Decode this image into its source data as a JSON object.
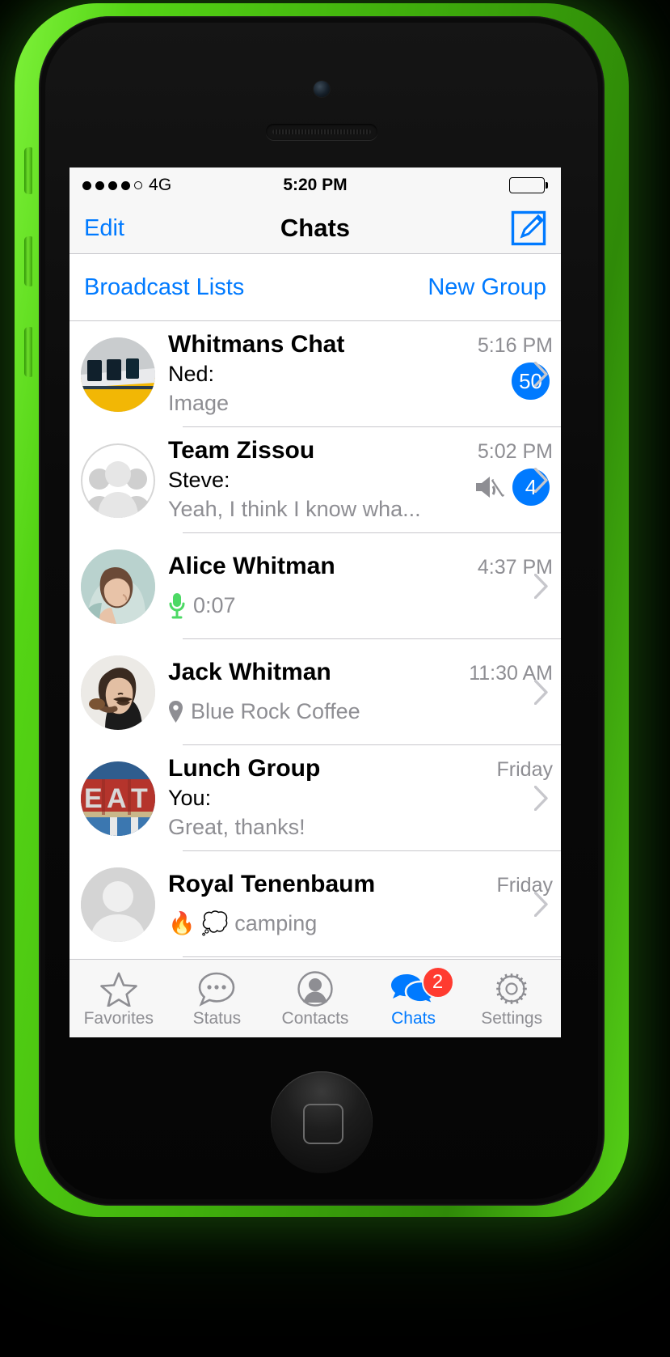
{
  "device": {
    "name": "iphone-5c-green"
  },
  "status_bar": {
    "signal_dots_filled": 4,
    "signal_dots_total": 5,
    "carrier": "4G",
    "time": "5:20 PM",
    "battery_full": true
  },
  "nav_bar": {
    "edit_label": "Edit",
    "title": "Chats",
    "compose_icon": "compose-square-pencil-icon"
  },
  "broadcast_bar": {
    "broadcast_label": "Broadcast Lists",
    "new_group_label": "New Group"
  },
  "colors": {
    "accent_blue": "#007aff",
    "badge_red": "#ff3b30",
    "mic_green": "#4cd964",
    "secondary_text": "#8e8e93",
    "separator": "#c8c7cc",
    "bar_background": "#f7f7f7",
    "phone_body": "#54d415"
  },
  "chats": [
    {
      "name": "Whitmans Chat",
      "time": "5:16 PM",
      "sender": "Ned:",
      "message": "Image",
      "badge": "50",
      "muted": false,
      "avatar": "train-photo",
      "avatar_type": "photo"
    },
    {
      "name": "Team Zissou",
      "time": "5:02 PM",
      "sender": "Steve:",
      "message": "Yeah, I think I know wha...",
      "badge": "4",
      "muted": true,
      "avatar": "group-silhouette-icon",
      "avatar_type": "group"
    },
    {
      "name": "Alice Whitman",
      "time": "4:37 PM",
      "sender": "",
      "message": "0:07",
      "badge": "",
      "muted": false,
      "avatar": "woman-hood-photo",
      "avatar_type": "photo",
      "attachment_icon": "microphone-icon"
    },
    {
      "name": "Jack Whitman",
      "time": "11:30 AM",
      "sender": "",
      "message": "Blue Rock Coffee",
      "badge": "",
      "muted": false,
      "avatar": "man-mustache-pipe-photo",
      "avatar_type": "photo",
      "attachment_icon": "location-pin-icon"
    },
    {
      "name": "Lunch Group",
      "time": "Friday",
      "sender": "You:",
      "message": "Great, thanks!",
      "badge": "",
      "muted": false,
      "avatar": "eat-sign-photo",
      "avatar_type": "photo"
    },
    {
      "name": "Royal Tenenbaum",
      "time": "Friday",
      "sender": "",
      "message": "🔥 💭 camping",
      "badge": "",
      "muted": false,
      "avatar": "person-silhouette-icon",
      "avatar_type": "placeholder"
    }
  ],
  "tab_bar": {
    "items": [
      {
        "label": "Favorites",
        "icon": "star-icon",
        "active": false,
        "badge": ""
      },
      {
        "label": "Status",
        "icon": "speech-bubble-dots-icon",
        "active": false,
        "badge": ""
      },
      {
        "label": "Contacts",
        "icon": "person-icon",
        "active": false,
        "badge": ""
      },
      {
        "label": "Chats",
        "icon": "chats-double-bubble-icon",
        "active": true,
        "badge": "2"
      },
      {
        "label": "Settings",
        "icon": "gear-icon",
        "active": false,
        "badge": ""
      }
    ]
  }
}
